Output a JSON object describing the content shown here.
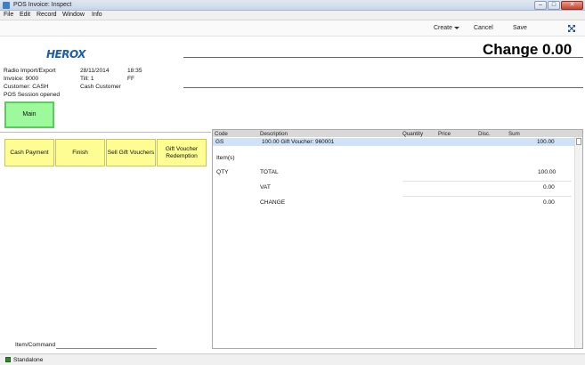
{
  "window": {
    "title": "POS Invoice: Inspect",
    "min": "–",
    "max": "□",
    "close": "✕"
  },
  "menu": [
    "File",
    "Edit",
    "Record",
    "Window",
    "Info"
  ],
  "toolbar": {
    "create": "Create",
    "cancel": "Cancel",
    "save": "Save"
  },
  "header": {
    "logo": "HEROX",
    "change": "Change 0.00",
    "company": "Radio Import/Export",
    "date": "28/11/2014",
    "time": "18:35",
    "invoice": "Invoice: 9000",
    "till": "Till: 1",
    "till_code": "FF",
    "customer": "Customer: CASH",
    "customer_name": "Cash Customer",
    "session": "POS Session opened"
  },
  "buttons": {
    "main": "Main",
    "cash_payment": "Cash Payment",
    "finish": "Finish",
    "sell_gift": "Sell Gift Vouchers",
    "gift_redemption": "Gift Voucher Redemption"
  },
  "grid": {
    "columns": [
      "Code",
      "Description",
      "Quantity",
      "Price",
      "Disc.",
      "Sum"
    ],
    "rows": [
      {
        "code": "GS",
        "description": "100.00 Gift Voucher: 960001",
        "quantity": "",
        "price": "",
        "disc": "",
        "sum": "100.00"
      }
    ]
  },
  "summary": {
    "items_label": "Item(s)",
    "qty_label": "QTY",
    "total_label": "TOTAL",
    "total": "100.00",
    "vat_label": "VAT",
    "vat": "0.00",
    "change_label": "CHANGE",
    "change": "0.00"
  },
  "command": {
    "label": "Item/Command",
    "value": ""
  },
  "status": {
    "text": "Standalone"
  }
}
